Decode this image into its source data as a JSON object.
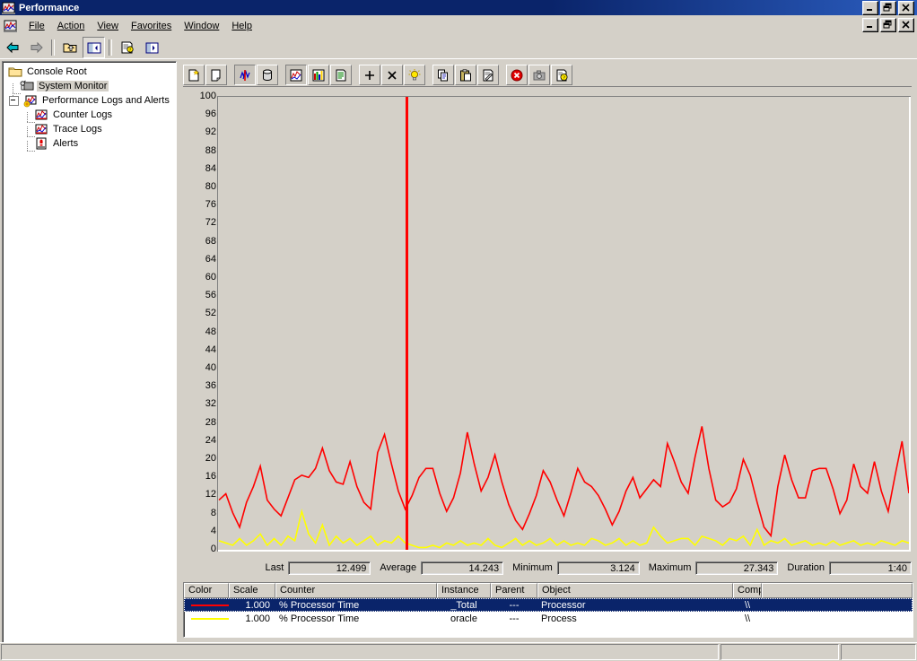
{
  "window": {
    "title": "Performance",
    "icon": "performance-icon",
    "buttons": {
      "minimize": "_",
      "restore": "restore",
      "close": "X"
    }
  },
  "menu": {
    "icon": "console-icon",
    "items": [
      {
        "label": "File",
        "accel": "F"
      },
      {
        "label": "Action",
        "accel": "A"
      },
      {
        "label": "View",
        "accel": "V"
      },
      {
        "label": "Favorites",
        "accel": "o"
      },
      {
        "label": "Window",
        "accel": "W"
      },
      {
        "label": "Help",
        "accel": "H"
      }
    ],
    "child_buttons": {
      "minimize": "_",
      "restore": "restore",
      "close": "X"
    }
  },
  "navtoolbar": {
    "buttons": [
      {
        "name": "back-icon",
        "title": "Back"
      },
      {
        "name": "forward-icon",
        "title": "Forward"
      },
      {
        "name": "up-one-level-icon",
        "title": "Up One Level"
      },
      {
        "name": "show-hide-console-tree-icon",
        "title": "Show/Hide Console Tree",
        "pressed": true
      },
      {
        "name": "properties-icon",
        "title": "Properties"
      },
      {
        "name": "export-list-icon",
        "title": "Export List"
      }
    ]
  },
  "tree": {
    "nodes": [
      {
        "label": "Console Root",
        "icon": "folder-icon",
        "level": 0,
        "selected": false,
        "expander": false
      },
      {
        "label": "System Monitor",
        "icon": "system-monitor-icon",
        "level": 1,
        "selected": true,
        "expander": false
      },
      {
        "label": "Performance Logs and Alerts",
        "icon": "performance-logs-icon",
        "level": 1,
        "selected": false,
        "expander": true
      },
      {
        "label": "Counter Logs",
        "icon": "counter-logs-icon",
        "level": 2,
        "selected": false,
        "expander": false
      },
      {
        "label": "Trace Logs",
        "icon": "trace-logs-icon",
        "level": 2,
        "selected": false,
        "expander": false
      },
      {
        "label": "Alerts",
        "icon": "alerts-icon",
        "level": 2,
        "selected": false,
        "expander": false
      }
    ]
  },
  "graph_toolbar": {
    "buttons": [
      {
        "name": "new-counter-set-icon",
        "title": "New Counter Set"
      },
      {
        "name": "clear-display-icon",
        "title": "Clear Display"
      },
      {
        "name": "view-current-activity-icon",
        "title": "View Current Activity",
        "pressed": true
      },
      {
        "name": "view-log-data-icon",
        "title": "View Log File Data"
      },
      {
        "name": "view-graph-icon",
        "title": "View Graph",
        "pressed": true
      },
      {
        "name": "view-histogram-icon",
        "title": "View Histogram"
      },
      {
        "name": "view-report-icon",
        "title": "View Report"
      },
      {
        "name": "add-counter-icon",
        "title": "Add"
      },
      {
        "name": "delete-counter-icon",
        "title": "Delete"
      },
      {
        "name": "highlight-icon",
        "title": "Highlight"
      },
      {
        "name": "copy-properties-icon",
        "title": "Copy Properties"
      },
      {
        "name": "paste-counter-list-icon",
        "title": "Paste Counter List"
      },
      {
        "name": "properties-icon",
        "title": "Properties"
      },
      {
        "name": "freeze-display-icon",
        "title": "Freeze Display"
      },
      {
        "name": "update-data-icon",
        "title": "Update Data"
      },
      {
        "name": "help-icon",
        "title": "Help"
      }
    ]
  },
  "value_bar": {
    "fields": [
      {
        "label": "Last",
        "value": "12.499"
      },
      {
        "label": "Average",
        "value": "14.243"
      },
      {
        "label": "Minimum",
        "value": "3.124"
      },
      {
        "label": "Maximum",
        "value": "27.343"
      },
      {
        "label": "Duration",
        "value": "1:40"
      }
    ]
  },
  "legend": {
    "columns": [
      "Color",
      "Scale",
      "Counter",
      "Instance",
      "Parent",
      "Object",
      "Computer",
      ""
    ],
    "rows": [
      {
        "color": "#ff0000",
        "scale": "1.000",
        "counter": "% Processor Time",
        "instance": "_Total",
        "parent": "---",
        "object": "Processor",
        "computer": "\\\\",
        "extra": "",
        "selected": true
      },
      {
        "color": "#ffff00",
        "scale": "1.000",
        "counter": "% Processor Time",
        "instance": "oracle",
        "parent": "---",
        "object": "Process",
        "computer": "\\\\",
        "extra": "",
        "selected": false
      }
    ]
  },
  "statusbar": {
    "text": "",
    "panel2": "",
    "panel3": ""
  },
  "chart_data": {
    "type": "line",
    "title": "System Monitor",
    "xlabel": "",
    "ylabel": "",
    "ylim": [
      0,
      100
    ],
    "yticks": [
      0,
      4,
      8,
      12,
      16,
      20,
      24,
      28,
      32,
      36,
      40,
      44,
      48,
      52,
      56,
      60,
      64,
      68,
      72,
      76,
      80,
      84,
      88,
      92,
      96,
      100
    ],
    "grid": false,
    "legend_position": "bottom",
    "background": "#d4d0c8",
    "duration_seconds": 100,
    "time_cursor_index": 27,
    "statistics": {
      "last": 12.499,
      "average": 14.243,
      "minimum": 3.124,
      "maximum": 27.343,
      "duration": "1:40"
    },
    "series": [
      {
        "name": "Processor / % Processor Time / _Total",
        "color": "#ff0000",
        "scale": 1.0,
        "values": [
          11.0,
          12.4,
          8.2,
          5.0,
          10.5,
          14.0,
          18.5,
          11.0,
          9.0,
          7.5,
          11.5,
          15.5,
          16.5,
          16.0,
          18.0,
          22.5,
          17.5,
          15.0,
          14.5,
          19.5,
          14.0,
          10.5,
          9.0,
          21.5,
          25.5,
          19.0,
          13.0,
          9.0,
          12.0,
          16.0,
          18.0,
          18.0,
          12.5,
          8.5,
          11.5,
          17.0,
          26.0,
          19.0,
          13.0,
          16.0,
          21.0,
          15.0,
          10.0,
          6.5,
          4.5,
          8.0,
          12.0,
          17.5,
          15.0,
          11.0,
          7.5,
          12.5,
          18.0,
          15.0,
          14.0,
          12.0,
          9.0,
          5.5,
          8.5,
          13.0,
          16.0,
          11.5,
          13.5,
          15.5,
          14.0,
          23.5,
          19.5,
          15.0,
          12.5,
          20.5,
          27.3,
          18.0,
          11.0,
          9.5,
          10.5,
          13.5,
          20.0,
          16.5,
          10.5,
          5.0,
          3.1,
          14.0,
          21.0,
          15.5,
          11.5,
          11.5,
          17.5,
          18.0,
          18.0,
          13.5,
          8.0,
          11.0,
          19.0,
          14.0,
          12.5,
          19.5,
          13.0,
          8.5,
          16.5,
          24.0,
          12.5
        ]
      },
      {
        "name": "Process / % Processor Time / oracle",
        "color": "#ffff00",
        "scale": 1.0,
        "values": [
          2.0,
          1.5,
          1.0,
          2.5,
          1.0,
          2.0,
          3.5,
          1.0,
          2.5,
          1.0,
          3.0,
          2.0,
          8.5,
          3.5,
          1.5,
          5.5,
          1.0,
          3.0,
          1.5,
          2.5,
          1.0,
          2.0,
          3.0,
          1.0,
          2.0,
          1.5,
          3.0,
          1.5,
          1.0,
          0.5,
          0.5,
          1.0,
          0.5,
          1.5,
          1.0,
          2.0,
          1.0,
          1.5,
          1.0,
          2.5,
          1.0,
          0.5,
          1.5,
          2.5,
          1.0,
          2.0,
          1.0,
          1.5,
          2.5,
          1.0,
          2.0,
          1.0,
          1.5,
          1.0,
          2.5,
          2.0,
          1.0,
          1.5,
          2.5,
          1.0,
          2.0,
          1.0,
          1.5,
          5.0,
          3.0,
          1.5,
          2.0,
          2.5,
          2.5,
          1.0,
          3.0,
          2.5,
          2.0,
          1.0,
          2.5,
          2.0,
          3.0,
          1.0,
          4.5,
          1.0,
          2.0,
          1.5,
          2.5,
          1.0,
          1.5,
          2.0,
          1.0,
          1.5,
          1.0,
          2.0,
          1.0,
          1.5,
          2.0,
          1.0,
          1.5,
          1.0,
          2.0,
          1.5,
          1.0,
          2.0,
          1.5
        ]
      }
    ]
  }
}
